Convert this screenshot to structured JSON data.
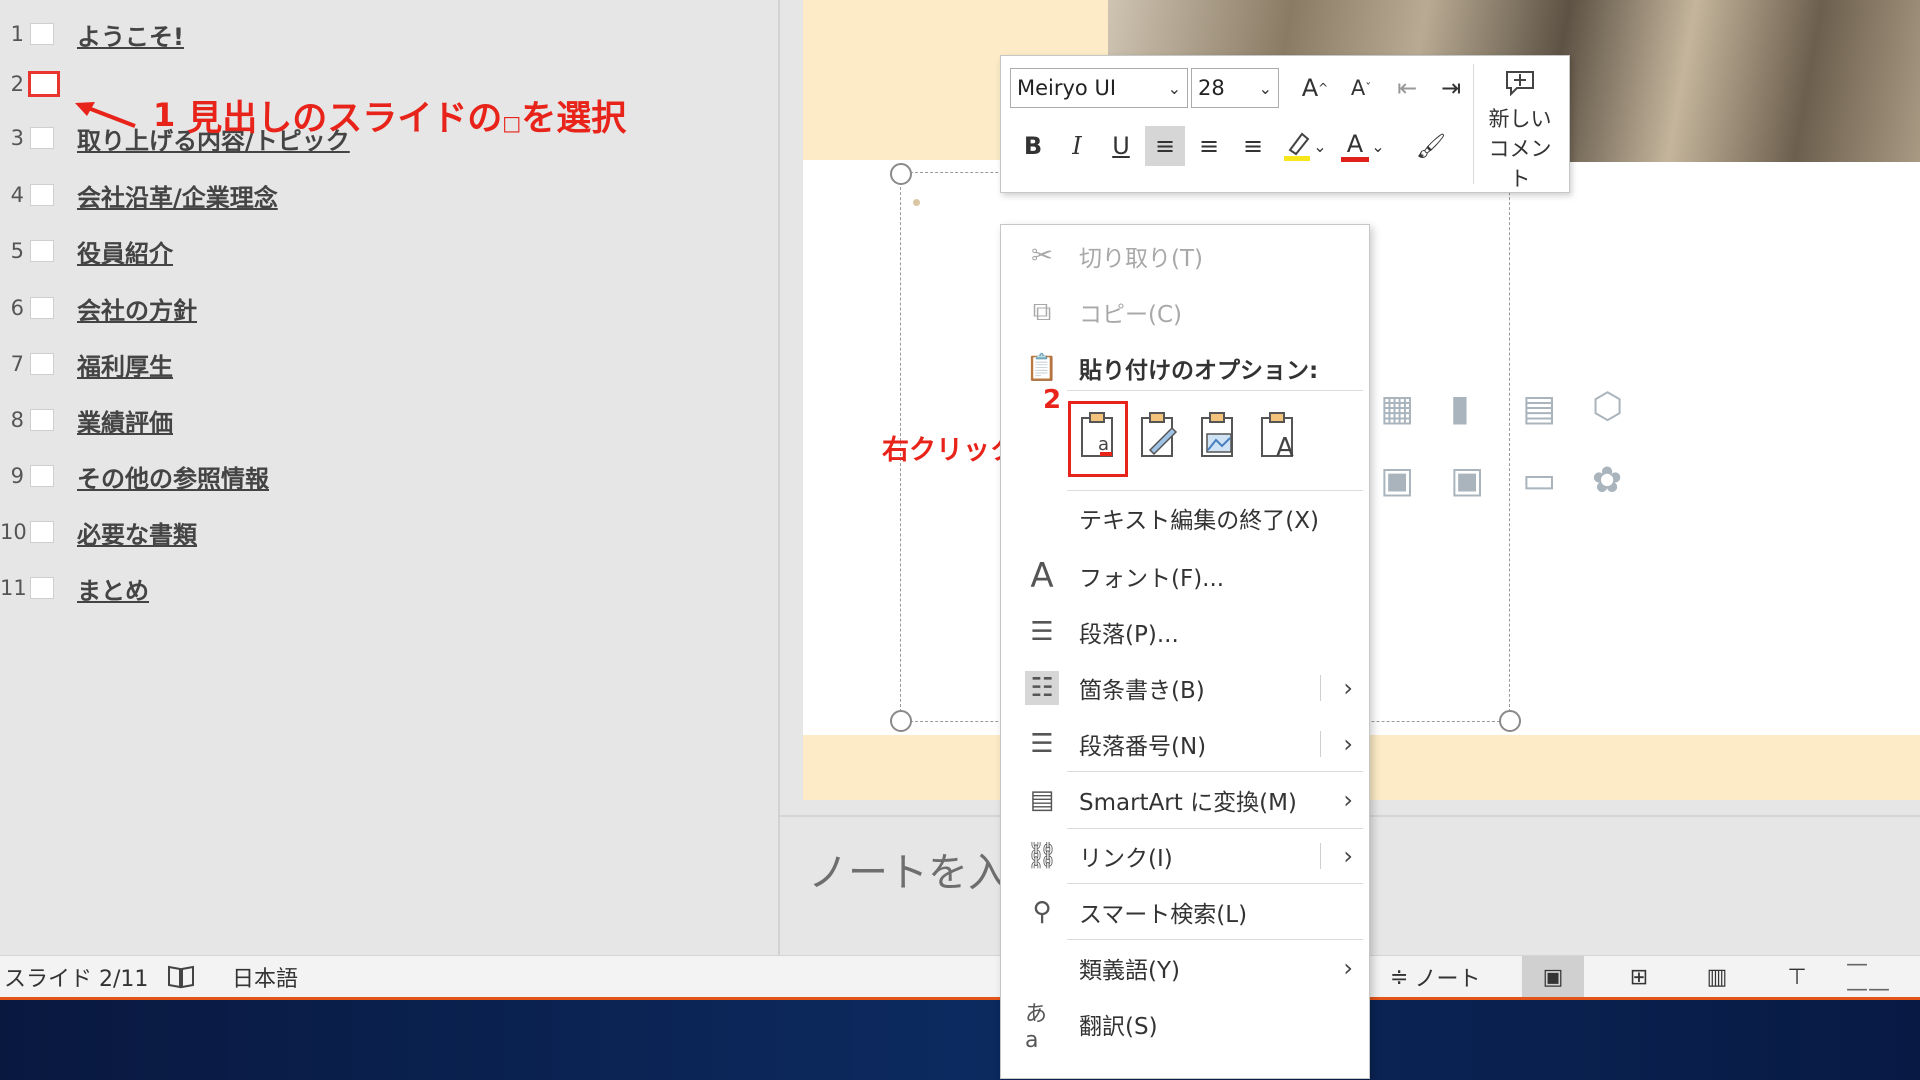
{
  "outline": {
    "slides": [
      {
        "num": "1",
        "title": "ようこそ!"
      },
      {
        "num": "2",
        "title": ""
      },
      {
        "num": "3",
        "title": "取り上げる内容/トピック"
      },
      {
        "num": "4",
        "title": "会社沿革/企業理念"
      },
      {
        "num": "5",
        "title": "役員紹介"
      },
      {
        "num": "6",
        "title": "会社の方針"
      },
      {
        "num": "7",
        "title": "福利厚生"
      },
      {
        "num": "8",
        "title": "業績評価"
      },
      {
        "num": "9",
        "title": "その他の参照情報"
      },
      {
        "num": "10",
        "title": "必要な書類"
      },
      {
        "num": "11",
        "title": "まとめ"
      }
    ],
    "selected_index": 2
  },
  "annotations": {
    "step1_number": "1",
    "step1_text_before": "見出しのスライドの",
    "step1_text_glyph": "□",
    "step1_text_after": "を選択",
    "right_click": "右クリック",
    "step2_number": "2",
    "accent_color": "#e8231a"
  },
  "mini_toolbar": {
    "font_name": "Meiryo UI",
    "font_size": "28",
    "new_comment_line1": "新しい",
    "new_comment_line2": "コメント",
    "buttons": [
      "grow-font",
      "shrink-font",
      "decrease-indent",
      "increase-indent",
      "bold",
      "italic",
      "underline",
      "align-left",
      "align-center",
      "align-right",
      "highlight",
      "font-color",
      "format-painter"
    ]
  },
  "context_menu": {
    "cut": "切り取り(T)",
    "copy": "コピー(C)",
    "paste_options": "貼り付けのオプション:",
    "end_text_edit": "テキスト編集の終了(X)",
    "font": "フォント(F)...",
    "paragraph": "段落(P)...",
    "bullets": "箇条書き(B)",
    "numbering": "段落番号(N)",
    "smartart": "SmartArt に変換(M)",
    "link": "リンク(I)",
    "smart_lookup": "スマート検索(L)",
    "synonyms": "類義語(Y)",
    "translate": "翻訳(S)"
  },
  "notes": {
    "placeholder": "ノートを入力"
  },
  "status_bar": {
    "slide_info": "スライド 2/11",
    "language": "日本語",
    "notes_button": "ノート"
  }
}
